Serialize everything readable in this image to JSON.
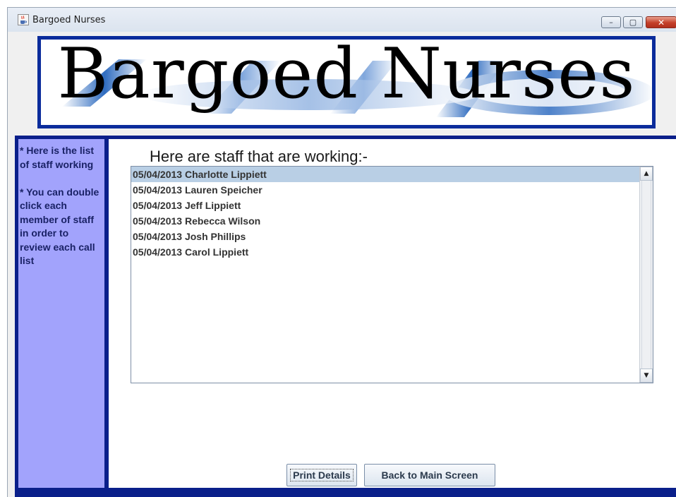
{
  "window": {
    "title": "Bargoed Nurses",
    "controls": {
      "minimize": "–",
      "maximize": "▢",
      "close": "✕"
    }
  },
  "banner": {
    "title": "Bargoed Nurses",
    "border_color": "#0b2c9b"
  },
  "sidebar": {
    "help_text": "* Here is the list\nof staff working\n\n* You can double\nclick each\nmember of staff\nin order to\nreview each call\nlist",
    "background": "#a2a3fc"
  },
  "main": {
    "heading": "Here are staff that are working:-",
    "staff_list": [
      "05/04/2013 Charlotte Lippiett",
      "05/04/2013 Lauren Speicher",
      "05/04/2013 Jeff Lippiett",
      "05/04/2013 Rebecca Wilson",
      "05/04/2013 Josh Phillips",
      "05/04/2013 Carol Lippiett"
    ],
    "selected_index": 0
  },
  "buttons": {
    "print_label": "Print Details",
    "back_label": "Back to Main Screen"
  },
  "colors": {
    "frame": "#0a1f8a",
    "selection": "#b9cfe5"
  },
  "icons": {
    "app": "java-coffee-cup-icon",
    "scroll_up": "arrow-up-icon",
    "scroll_down": "arrow-down-icon"
  }
}
